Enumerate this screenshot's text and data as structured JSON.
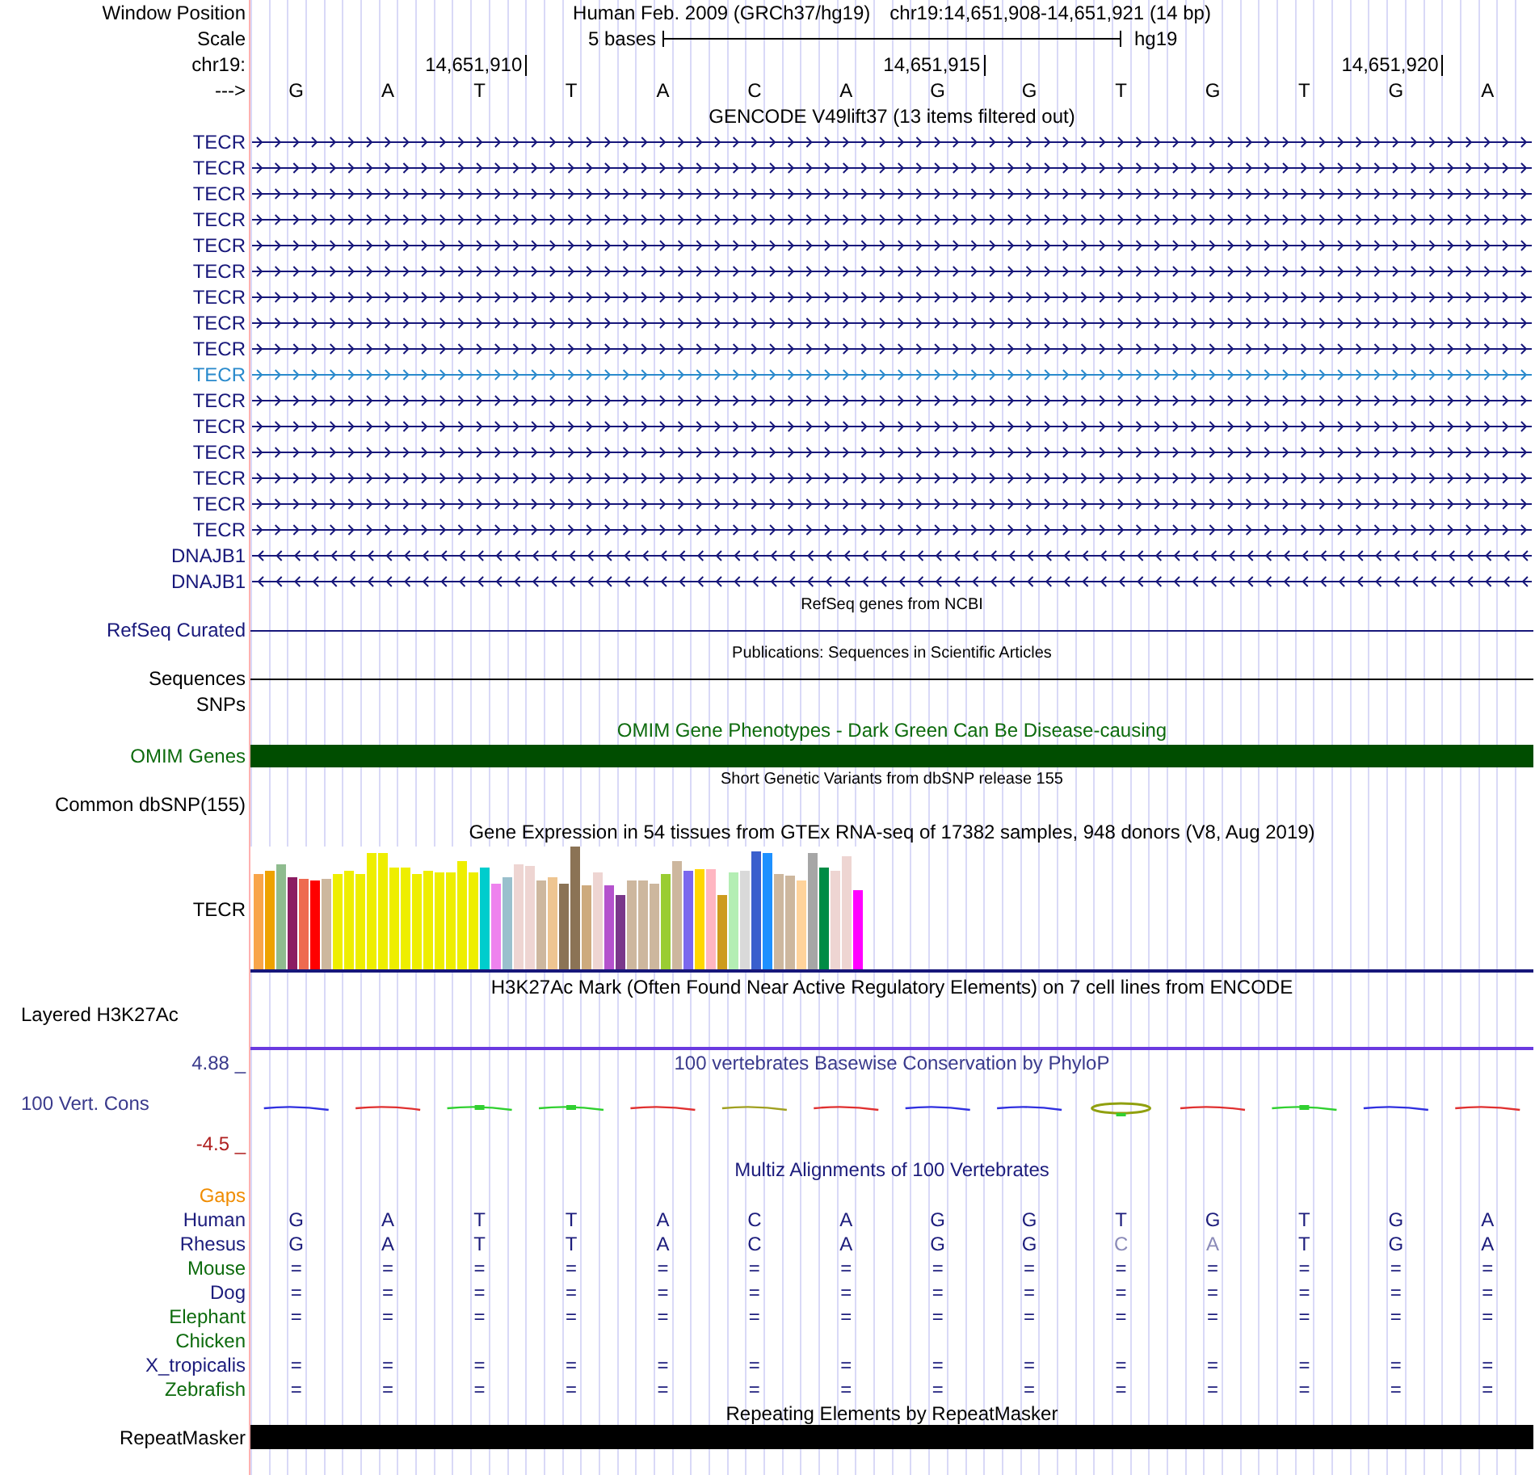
{
  "position": {
    "window_label": "Window Position",
    "assembly": "Human Feb. 2009 (GRCh37/hg19)",
    "range": "chr19:14,651,908-14,651,921 (14 bp)",
    "scale_label": "Scale",
    "scale_text": "5 bases",
    "scale_db": "hg19",
    "chrom_label": "chr19:",
    "strand_label": "--->",
    "bases": [
      {
        "base": "G"
      },
      {
        "base": "A"
      },
      {
        "base": "T",
        "tick": "14,651,910"
      },
      {
        "base": "T"
      },
      {
        "base": "A"
      },
      {
        "base": "C"
      },
      {
        "base": "A"
      },
      {
        "base": "G",
        "tick": "14,651,915"
      },
      {
        "base": "G"
      },
      {
        "base": "T"
      },
      {
        "base": "G"
      },
      {
        "base": "T"
      },
      {
        "base": "G",
        "tick": "14,651,920"
      },
      {
        "base": "A"
      }
    ]
  },
  "gencode": {
    "title": "GENCODE V49lift37 (13 items filtered out)",
    "genes": [
      {
        "name": "TECR",
        "kind": "forward",
        "highlighted": false
      },
      {
        "name": "TECR",
        "kind": "forward",
        "highlighted": false
      },
      {
        "name": "TECR",
        "kind": "forward",
        "highlighted": false
      },
      {
        "name": "TECR",
        "kind": "forward",
        "highlighted": false
      },
      {
        "name": "TECR",
        "kind": "forward",
        "highlighted": false
      },
      {
        "name": "TECR",
        "kind": "forward",
        "highlighted": false
      },
      {
        "name": "TECR",
        "kind": "forward",
        "highlighted": false
      },
      {
        "name": "TECR",
        "kind": "forward",
        "highlighted": false
      },
      {
        "name": "TECR",
        "kind": "forward",
        "highlighted": false
      },
      {
        "name": "TECR",
        "kind": "forward",
        "highlighted": true
      },
      {
        "name": "TECR",
        "kind": "forward",
        "highlighted": false
      },
      {
        "name": "TECR",
        "kind": "forward",
        "highlighted": false
      },
      {
        "name": "TECR",
        "kind": "forward",
        "highlighted": false
      },
      {
        "name": "TECR",
        "kind": "forward",
        "highlighted": false
      },
      {
        "name": "TECR",
        "kind": "forward",
        "highlighted": false
      },
      {
        "name": "TECR",
        "kind": "forward",
        "highlighted": false
      },
      {
        "name": "DNAJB1",
        "kind": "reverse",
        "highlighted": false
      },
      {
        "name": "DNAJB1",
        "kind": "reverse",
        "highlighted": false
      }
    ]
  },
  "refseq": {
    "title": "RefSeq genes from NCBI",
    "label": "RefSeq Curated"
  },
  "publications": {
    "title": "Publications: Sequences in Scientific Articles",
    "label": "Sequences"
  },
  "snps": {
    "label": "SNPs"
  },
  "omim": {
    "title": "OMIM Gene Phenotypes - Dark Green Can Be Disease-causing",
    "label": "OMIM Genes"
  },
  "dbsnp": {
    "title": "Short Genetic Variants from dbSNP release 155",
    "label": "Common dbSNP(155)"
  },
  "gtex": {
    "title": "Gene Expression in 54 tissues from GTEx RNA-seq of 17382 samples, 948 donors (V8, Aug 2019)",
    "label": "TECR"
  },
  "h3k27ac": {
    "title": "H3K27Ac Mark (Often Found Near Active Regulatory Elements) on 7 cell lines from ENCODE",
    "label": "Layered H3K27Ac"
  },
  "conservation": {
    "title": "100 vertebrates Basewise Conservation by PhyloP",
    "label": "100 Vert. Cons",
    "max": "4.88 _",
    "min": "-4.5 _"
  },
  "multiz": {
    "title": "Multiz Alignments of 100 Vertebrates",
    "gaps_label": "Gaps",
    "species": [
      {
        "name": "Human",
        "color": "#1c1c7c",
        "cells": [
          "G",
          "A",
          "T",
          "T",
          "A",
          "C",
          "A",
          "G",
          "G",
          "T",
          "G",
          "T",
          "G",
          "A"
        ]
      },
      {
        "name": "Rhesus",
        "color": "#1c1c7c",
        "cells": [
          "G",
          "A",
          "T",
          "T",
          "A",
          "C",
          "A",
          "G",
          "G",
          "C",
          "A",
          "T",
          "G",
          "A"
        ],
        "faded": [
          false,
          false,
          false,
          false,
          false,
          false,
          false,
          false,
          false,
          true,
          true,
          false,
          false,
          false
        ]
      },
      {
        "name": "Mouse",
        "color": "#0d6b0d",
        "cells": [
          "=",
          "=",
          "=",
          "=",
          "=",
          "=",
          "=",
          "=",
          "=",
          "=",
          "=",
          "=",
          "=",
          "="
        ]
      },
      {
        "name": "Dog",
        "color": "#1c1c7c",
        "cells": [
          "=",
          "=",
          "=",
          "=",
          "=",
          "=",
          "=",
          "=",
          "=",
          "=",
          "=",
          "=",
          "=",
          "="
        ]
      },
      {
        "name": "Elephant",
        "color": "#0d6b0d",
        "cells": [
          "=",
          "=",
          "=",
          "=",
          "=",
          "=",
          "=",
          "=",
          "=",
          "=",
          "=",
          "=",
          "=",
          "="
        ]
      },
      {
        "name": "Chicken",
        "color": "#0d6b0d"
      },
      {
        "name": "X_tropicalis",
        "color": "#1c1c7c",
        "cells": [
          "=",
          "=",
          "=",
          "=",
          "=",
          "=",
          "=",
          "=",
          "=",
          "=",
          "=",
          "=",
          "=",
          "="
        ]
      },
      {
        "name": "Zebrafish",
        "color": "#0d6b0d",
        "cells": [
          "=",
          "=",
          "=",
          "=",
          "=",
          "=",
          "=",
          "=",
          "=",
          "=",
          "=",
          "=",
          "=",
          "="
        ]
      }
    ]
  },
  "repeatmasker": {
    "title": "Repeating Elements by RepeatMasker",
    "label": "RepeatMasker"
  }
}
